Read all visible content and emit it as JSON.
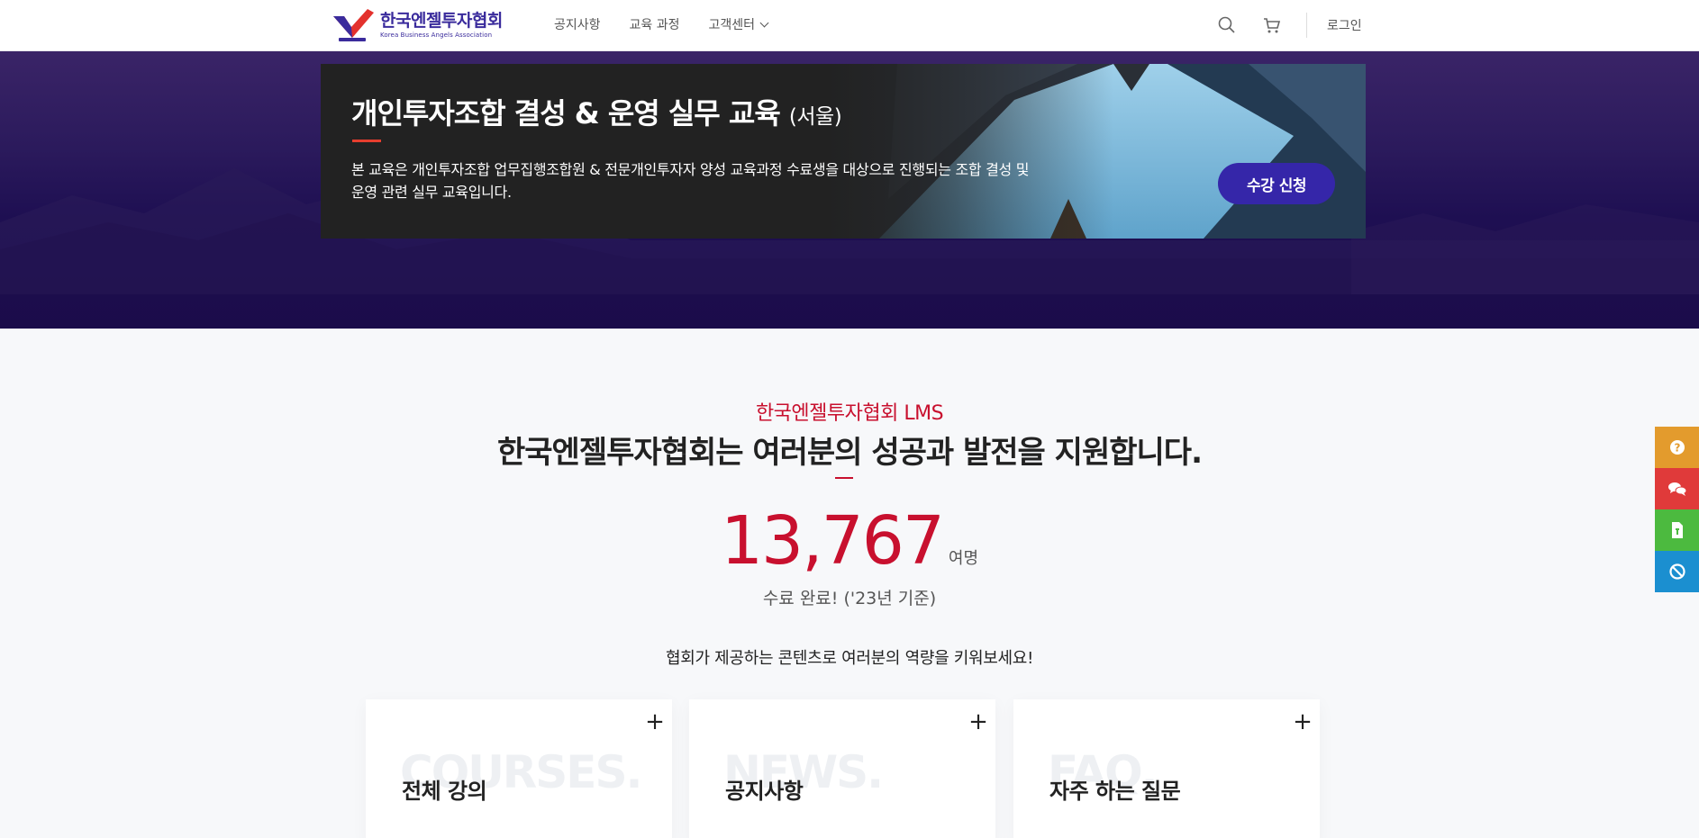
{
  "header": {
    "logo_ko": "한국엔젤투자협회",
    "logo_en": "Korea Business Angels Association",
    "nav": [
      {
        "label": "공지사항"
      },
      {
        "label": "교육 과정"
      },
      {
        "label": "고객센터"
      }
    ],
    "login_label": "로그인",
    "icons": [
      "search-icon",
      "cart-icon"
    ]
  },
  "banner": {
    "title": "개인투자조합 결성 & 운영 실무 교육",
    "title_suffix": "(서울)",
    "description": "본 교육은 개인투자조합 업무집행조합원 & 전문개인투자자 양성 교육과정 수료생을 대상으로 진행되는 조합 결성 및 운영 관련 실무 교육입니다.",
    "cta_label": "수강 신청"
  },
  "main": {
    "subtitle": "한국엔젤투자협회 LMS",
    "title": "한국엔젤투자협회는 여러분의 성공과 발전을 지원합니다.",
    "count": "13,767",
    "count_unit": "여명",
    "complete_text": "수료 완료! ('23년 기준)",
    "invite_text": "협회가 제공하는 콘텐츠로 여러분의 역량을 키워보세요!"
  },
  "cards": [
    {
      "ghost": "COURSES.",
      "title": "전체 강의",
      "plus": "+"
    },
    {
      "ghost": "NEWS.",
      "title": "공지사항",
      "plus": "+"
    },
    {
      "ghost": "FAQ.",
      "title": "자주 하는 질문",
      "plus": "+"
    }
  ],
  "quick_menu": [
    {
      "icon": "question-icon",
      "color": "#e39b2d"
    },
    {
      "icon": "chat-icon",
      "color": "#e03a3a"
    },
    {
      "icon": "document-icon",
      "color": "#4cba3f"
    },
    {
      "icon": "block-icon",
      "color": "#1b8fd0"
    }
  ],
  "colors": {
    "accent_red": "#c8102e",
    "brand_purple": "#3526a9",
    "hero_bg": "#1e0f52"
  }
}
